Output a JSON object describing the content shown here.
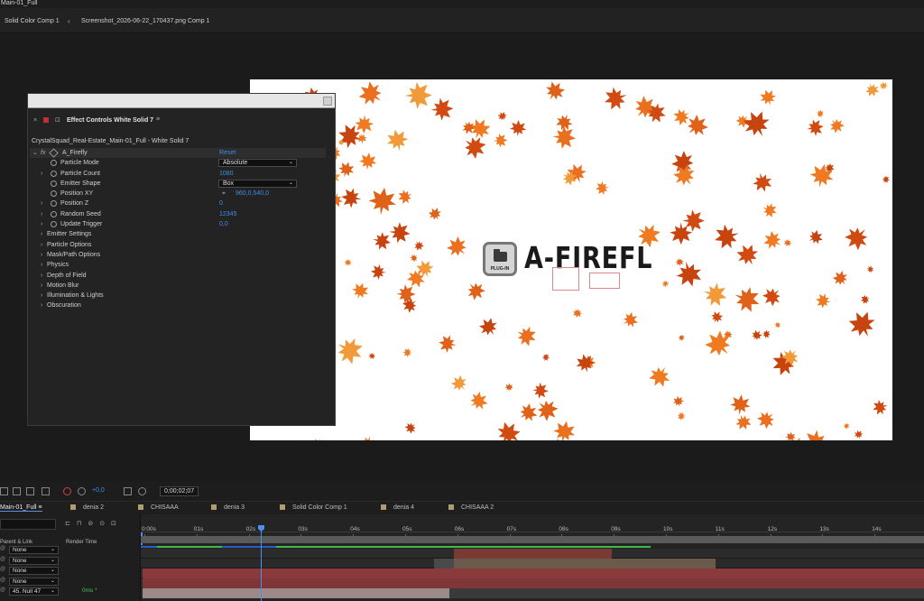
{
  "window": {
    "title": "Main-01_Full"
  },
  "breadcrumbs": {
    "first": "Solid Color Comp 1",
    "separator": "‹",
    "second": "Screenshot_2026-06-22_170437.png Comp 1"
  },
  "canvas": {
    "logo_text": "A-FIREFL",
    "badge_label": "PLUG-IN"
  },
  "effect_controls": {
    "panel_title": "Effect Controls White Solid 7",
    "layer_path": "CrystalSquad_Real-Estate_Main-01_Full - White Solid 7",
    "effect_name": "A_Firefly",
    "reset_label": "Reset",
    "fx_label": "fx",
    "props": [
      {
        "label": "Particle Mode",
        "value": "Absolute",
        "type": "dropdown"
      },
      {
        "label": "Particle Count",
        "value": "1080",
        "type": "number"
      },
      {
        "label": "Emitter Shape",
        "value": "Box",
        "type": "dropdown"
      },
      {
        "label": "Position XY",
        "value": "960,0,540,0",
        "type": "point"
      },
      {
        "label": "Position Z",
        "value": "0",
        "type": "number"
      },
      {
        "label": "Random Seed",
        "value": "12345",
        "type": "number"
      },
      {
        "label": "Update Trigger",
        "value": "0,0",
        "type": "number"
      }
    ],
    "groups": [
      "Emitter Settings",
      "Particle Options",
      "Mask/Path Options",
      "Physics",
      "Depth of Field",
      "Motion Blur",
      "Illumination & Lights",
      "Obscuration"
    ]
  },
  "viewer_toolbar": {
    "exposure": "+0,0",
    "timecode": "0;00;02;07"
  },
  "timeline": {
    "active_tab": "Main-01_Full",
    "tabs": [
      "denia 2",
      "CHISAAA",
      "denia 3",
      "Solid Color Comp 1",
      "denia 4",
      "CHISAAA 2"
    ],
    "columns": {
      "parent": "Parent & Link",
      "render_time": "Render Time"
    },
    "ticks": [
      "0:00s",
      "01s",
      "02s",
      "03s",
      "04s",
      "05s",
      "06s",
      "07s",
      "08s",
      "09s",
      "10s",
      "11s",
      "12s",
      "13s",
      "14s"
    ],
    "parent_rows": [
      {
        "value": "None",
        "render": ""
      },
      {
        "value": "None",
        "render": ""
      },
      {
        "value": "None",
        "render": ""
      },
      {
        "value": "None",
        "render": ""
      },
      {
        "value": "45. Null 47",
        "render": "0ms *"
      }
    ]
  },
  "colors": {
    "accent_blue": "#3d8ee8",
    "green": "#3fb94a",
    "track_red": "#8a3a3a",
    "label_tan": "#b19b72"
  }
}
